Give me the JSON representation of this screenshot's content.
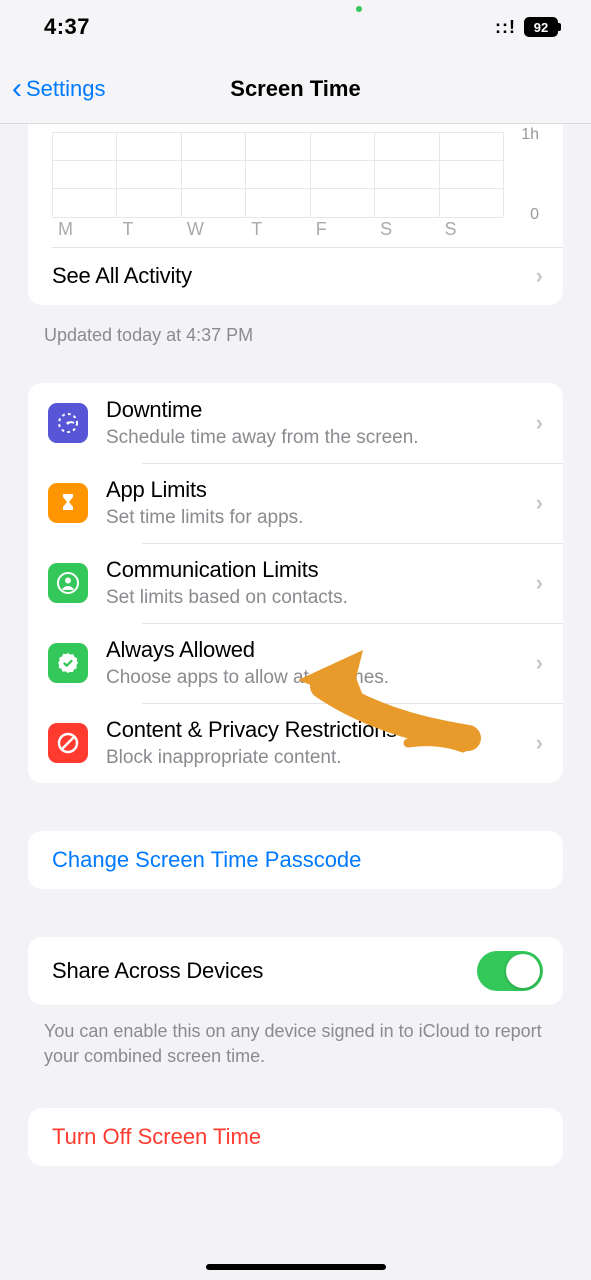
{
  "status": {
    "time": "4:37",
    "battery": "92"
  },
  "nav": {
    "back": "Settings",
    "title": "Screen Time"
  },
  "chart_data": {
    "type": "bar",
    "categories": [
      "M",
      "T",
      "W",
      "T",
      "F",
      "S",
      "S"
    ],
    "values": [
      0,
      0,
      0,
      0,
      0,
      0,
      0
    ],
    "ylim": [
      0,
      1
    ],
    "yticks": [
      "1h",
      "0"
    ]
  },
  "activity": {
    "see_all": "See All Activity",
    "updated": "Updated today at 4:37 PM"
  },
  "options": [
    {
      "title": "Downtime",
      "sub": "Schedule time away from the screen.",
      "icon": "downtime-icon",
      "color": "bg-purple"
    },
    {
      "title": "App Limits",
      "sub": "Set time limits for apps.",
      "icon": "hourglass-icon",
      "color": "bg-orange"
    },
    {
      "title": "Communication Limits",
      "sub": "Set limits based on contacts.",
      "icon": "contact-icon",
      "color": "bg-green"
    },
    {
      "title": "Always Allowed",
      "sub": "Choose apps to allow at all times.",
      "icon": "check-icon",
      "color": "bg-green"
    },
    {
      "title": "Content & Privacy Restrictions",
      "sub": "Block inappropriate content.",
      "icon": "nosign-icon",
      "color": "bg-red"
    }
  ],
  "passcode": {
    "label": "Change Screen Time Passcode"
  },
  "share": {
    "label": "Share Across Devices",
    "footer": "You can enable this on any device signed in to iCloud to report your combined screen time."
  },
  "turnoff": {
    "label": "Turn Off Screen Time"
  }
}
